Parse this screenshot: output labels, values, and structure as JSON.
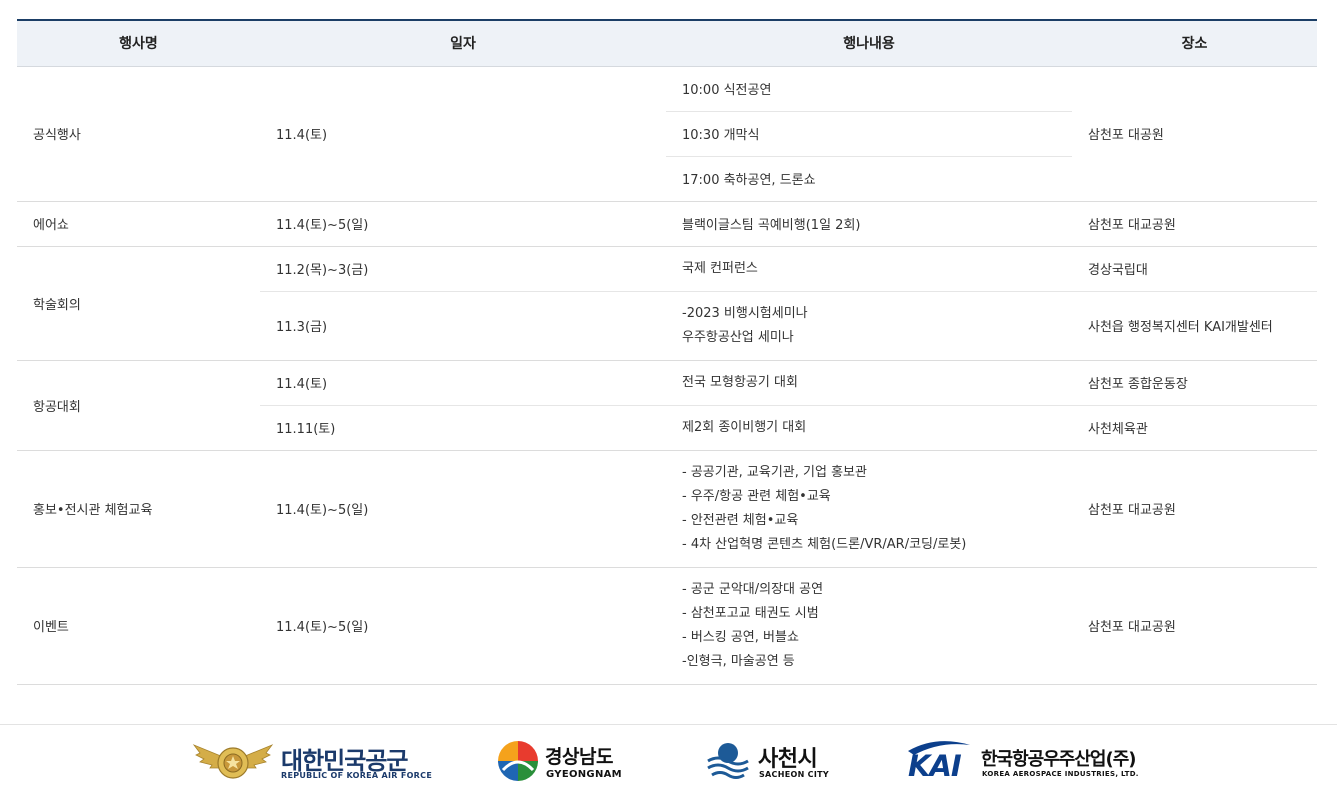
{
  "table": {
    "headers": [
      "행사명",
      "일자",
      "행나내용",
      "장소"
    ],
    "rows": [
      {
        "event": "공식행사",
        "date": "11.4(토)",
        "contents": [
          "10:00 식전공연",
          "10:30 개막식",
          "17:00 축하공연, 드론쇼"
        ],
        "place": "삼천포 대공원"
      },
      {
        "event": "에어쇼",
        "date": "11.4(토)~5(일)",
        "content": "블랙이글스팀 곡예비행(1일 2회)",
        "place": "삼천포 대교공원"
      },
      {
        "event": "학술회의",
        "subrows": [
          {
            "date": "11.2(목)~3(금)",
            "lines": [
              "국제 컨퍼런스"
            ],
            "place": "경상국립대"
          },
          {
            "date": "11.3(금)",
            "lines": [
              "-2023 비행시험세미나",
              "우주항공산업 세미나"
            ],
            "place": "사천읍 행정복지센터 KAI개발센터"
          }
        ]
      },
      {
        "event": "항공대회",
        "subrows": [
          {
            "date": "11.4(토)",
            "lines": [
              "전국 모형항공기 대회"
            ],
            "place": "삼천포 종합운동장"
          },
          {
            "date": "11.11(토)",
            "lines": [
              "제2회 종이비행기 대회"
            ],
            "place": "사천체육관"
          }
        ]
      },
      {
        "event": "홍보•전시관 체험교육",
        "date": "11.4(토)~5(일)",
        "lines": [
          "- 공공기관, 교육기관, 기업 홍보관",
          "- 우주/항공 관련 체험•교육",
          "- 안전관련 체험•교육",
          "- 4차 산업혁명 콘텐츠 체험(드론/VR/AR/코딩/로봇)"
        ],
        "place": "삼천포 대교공원"
      },
      {
        "event": "이벤트",
        "date": "11.4(토)~5(일)",
        "lines": [
          "- 공군 군악대/의장대 공연",
          "- 삼천포고교 태권도 시범",
          "- 버스킹 공연, 버블쇼",
          "-인형극, 마술공연 등"
        ],
        "place": "삼천포 대교공원"
      }
    ]
  },
  "footer": {
    "logos": [
      {
        "name": "대한민국공군",
        "sub": "REPUBLIC OF KOREA AIR FORCE",
        "icon": "air-force-emblem-icon",
        "color": "#1b3a6b"
      },
      {
        "name": "경상남도",
        "sub": "GYEONGNAM",
        "icon": "gyeongnam-circle-icon",
        "color": "#111111"
      },
      {
        "name": "사천시",
        "sub": "SACHEON CITY",
        "icon": "sacheon-wave-icon",
        "color": "#1d5a97"
      },
      {
        "name": "한국항공우주산업(주)",
        "sub": "KOREA AEROSPACE INDUSTRIES, LTD.",
        "mark": "KAI",
        "icon": "kai-swoosh-icon",
        "color": "#0c3f8c"
      }
    ]
  }
}
